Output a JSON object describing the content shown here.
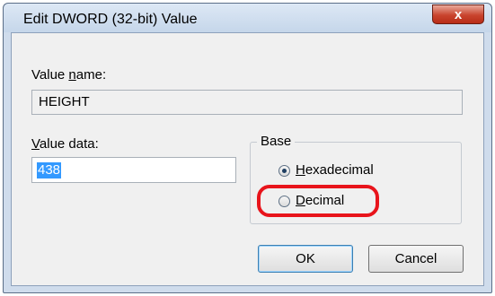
{
  "window": {
    "title": "Edit DWORD (32-bit) Value",
    "close_glyph": "x"
  },
  "value_name": {
    "label_prefix": "Value ",
    "label_accel": "n",
    "label_suffix": "ame:",
    "value": "HEIGHT"
  },
  "value_data": {
    "label_accel": "V",
    "label_suffix": "alue data:",
    "value": "438"
  },
  "base": {
    "label": "Base",
    "options": [
      {
        "accel": "H",
        "rest": "exadecimal",
        "checked": true
      },
      {
        "accel": "D",
        "rest": "ecimal",
        "checked": false
      }
    ]
  },
  "buttons": {
    "ok": "OK",
    "cancel": "Cancel"
  },
  "colors": {
    "highlight_ring": "#e8141b",
    "selection": "#3399ff"
  }
}
